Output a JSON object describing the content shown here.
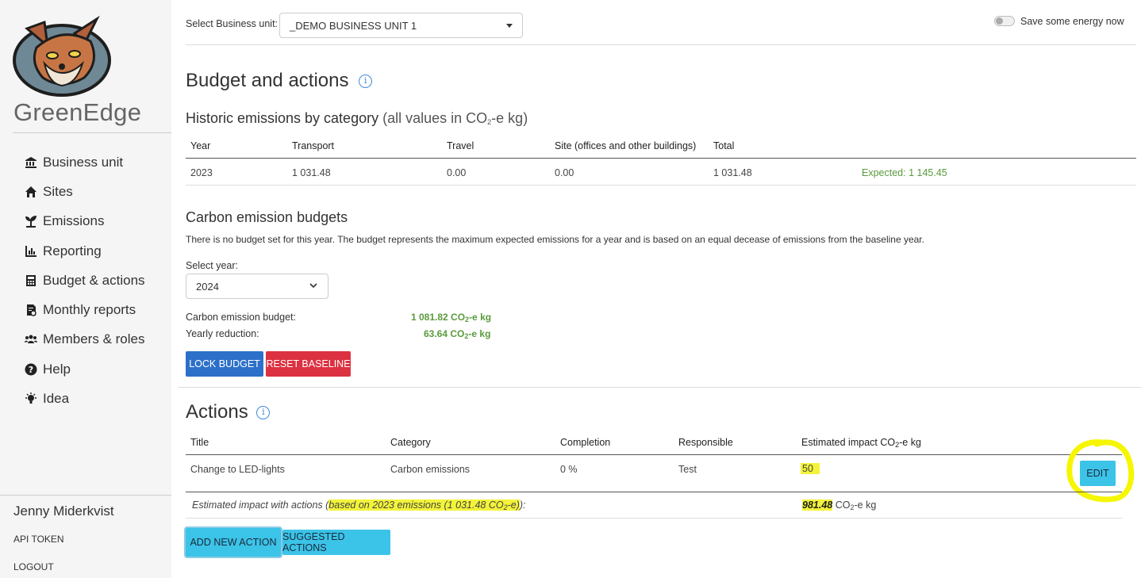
{
  "sidebar": {
    "brand": "GreenEdge",
    "items": [
      {
        "label": "Business unit",
        "icon": "bank-icon"
      },
      {
        "label": "Sites",
        "icon": "home-icon"
      },
      {
        "label": "Emissions",
        "icon": "seedling-icon"
      },
      {
        "label": "Reporting",
        "icon": "chart-icon"
      },
      {
        "label": "Budget & actions",
        "icon": "calculator-icon"
      },
      {
        "label": "Monthly reports",
        "icon": "report-icon"
      },
      {
        "label": "Members & roles",
        "icon": "users-icon"
      },
      {
        "label": "Help",
        "icon": "question-icon"
      },
      {
        "label": "Idea",
        "icon": "lightbulb-icon"
      }
    ],
    "user_name": "Jenny Miderkvist",
    "api_token": "API TOKEN",
    "logout": "LOGOUT"
  },
  "header": {
    "business_unit_label": "Select Business unit:",
    "business_unit_value": "_DEMO BUSINESS UNIT 1",
    "energy_toggle_label": "Save some energy now"
  },
  "page": {
    "title": "Budget and actions",
    "historic": {
      "title": "Historic emissions by category",
      "subtitle_prefix": "(all values in CO",
      "subtitle_sub": "2",
      "subtitle_suffix": "-e kg)",
      "columns": [
        "Year",
        "Transport",
        "Travel",
        "Site (offices and other buildings)",
        "Total"
      ],
      "rows": [
        {
          "year": "2023",
          "transport": "1 031.48",
          "travel": "0.00",
          "site": "0.00",
          "total": "1 031.48",
          "expected": "Expected: 1 145.45"
        }
      ]
    },
    "budgets": {
      "title": "Carbon emission budgets",
      "description": "There is no budget set for this year. The budget represents the maximum expected emissions for a year and is based on an equal decease of emissions from the baseline year.",
      "select_year_label": "Select year:",
      "select_year_value": "2024",
      "budget_label": "Carbon emission budget:",
      "budget_value": "1 081.82 CO",
      "reduction_label": "Yearly reduction:",
      "reduction_value": "63.64 CO",
      "unit_sub": "2",
      "unit_suffix": "-e kg",
      "lock_button": "LOCK BUDGET",
      "reset_button": "RESET BASELINE"
    },
    "actions": {
      "title": "Actions",
      "columns": {
        "title": "Title",
        "category": "Category",
        "completion": "Completion",
        "responsible": "Responsible",
        "impact_prefix": "Estimated impact CO",
        "impact_sub": "2",
        "impact_suffix": "-e kg"
      },
      "rows": [
        {
          "title": "Change to LED-lights",
          "category": "Carbon emissions",
          "completion": "0 %",
          "responsible": "Test",
          "impact": "50",
          "edit": "EDIT"
        }
      ],
      "summary_prefix": "Estimated impact with actions (",
      "summary_highlight": "based on 2023 emissions (1 031.48 CO",
      "summary_sub": "2",
      "summary_highlight_end": "-e)",
      "summary_suffix": "):",
      "summary_value": "981.48",
      "summary_unit_prefix": " CO",
      "summary_unit_sub": "2",
      "summary_unit_suffix": "-e kg",
      "add_button": "ADD NEW ACTION",
      "suggested_button": "SUGGESTED ACTIONS"
    }
  },
  "colors": {
    "primary_blue": "#2c70c9",
    "danger_red": "#dc3141",
    "cyan": "#3cc3e8",
    "green_text": "#5a9a3c",
    "highlight_yellow": "#f3f33a",
    "annotation_yellow": "#f6f600"
  }
}
